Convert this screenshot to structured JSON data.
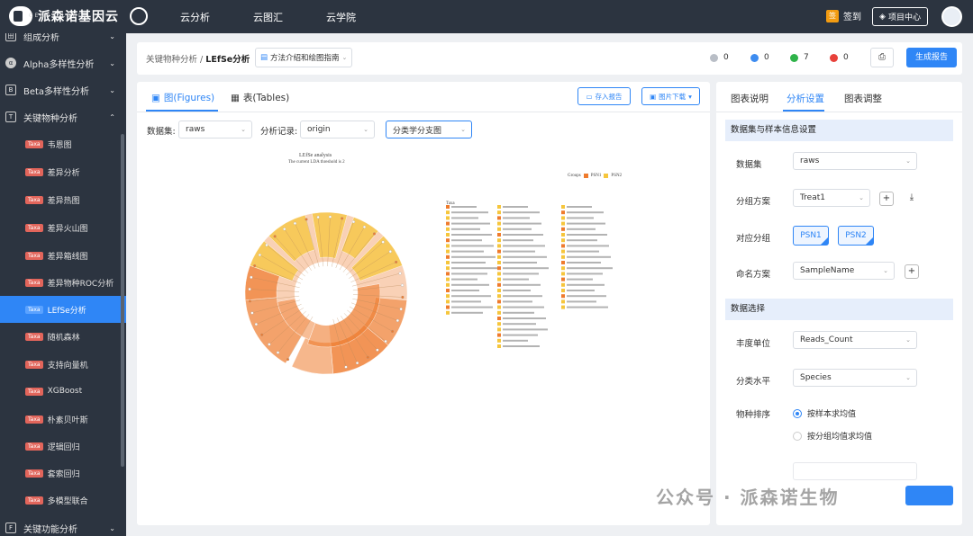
{
  "topbar": {
    "brand": "派森诺基因云",
    "brand_sub": "GENESCLOUD",
    "nav": [
      "云分析",
      "云图汇",
      "云学院"
    ],
    "sign_label": "签到",
    "project_label": "项目中心"
  },
  "sidebar": {
    "groups": [
      {
        "label": "组成分析"
      },
      {
        "label": "Alpha多样性分析"
      },
      {
        "label": "Beta多样性分析"
      },
      {
        "label": "关键物种分析"
      }
    ],
    "items": [
      {
        "tag": "Taxa",
        "label": "韦恩图"
      },
      {
        "tag": "Taxa",
        "label": "差异分析"
      },
      {
        "tag": "Taxa",
        "label": "差异热图"
      },
      {
        "tag": "Taxa",
        "label": "差异火山图"
      },
      {
        "tag": "Taxa",
        "label": "差异箱线图"
      },
      {
        "tag": "Taxa",
        "label": "差异物种ROC分析"
      },
      {
        "tag": "Taxa",
        "label": "LEfSe分析"
      },
      {
        "tag": "Taxa",
        "label": "随机森林"
      },
      {
        "tag": "Taxa",
        "label": "支持向量机"
      },
      {
        "tag": "Taxa",
        "label": "XGBoost"
      },
      {
        "tag": "Taxa",
        "label": "朴素贝叶斯"
      },
      {
        "tag": "Taxa",
        "label": "逻辑回归"
      },
      {
        "tag": "Taxa",
        "label": "套索回归"
      },
      {
        "tag": "Taxa",
        "label": "多模型联合"
      }
    ],
    "bottom_group": {
      "label": "关键功能分析"
    },
    "active_index": 6
  },
  "header": {
    "breadcrumb_parent": "关键物种分析",
    "breadcrumb_sep": "/",
    "breadcrumb_current": "LEfSe分析",
    "guide_label": "方法介绍和绘图指南",
    "stats": [
      {
        "color": "#b9bec6",
        "value": "0"
      },
      {
        "color": "#3d8cf0",
        "value": "0"
      },
      {
        "color": "#2fb34a",
        "value": "7"
      },
      {
        "color": "#e8413a",
        "value": "0"
      }
    ],
    "generate_label": "生成报告"
  },
  "main": {
    "tab_figures": "图(Figures)",
    "tab_tables": "表(Tables)",
    "save_report_label": "存入报告",
    "download_label": "图片下载",
    "dataset_label": "数据集:",
    "dataset_value": "raws",
    "record_label": "分析记录:",
    "record_value": "origin",
    "figure_type_value": "分类学分支图",
    "figure": {
      "title": "LEfSe analysis",
      "subtitle": "The current LDA threshold is 2",
      "legend_title": "Groups",
      "legend": [
        {
          "name": "PSN1",
          "color": "#ef7b2d"
        },
        {
          "name": "PSN2",
          "color": "#f6c63c"
        }
      ],
      "taxa_header": "Taxa"
    }
  },
  "right": {
    "tabs": [
      "图表说明",
      "分析设置",
      "图表调整"
    ],
    "active_tab": 1,
    "section1": "数据集与样本信息设置",
    "dataset_label": "数据集",
    "dataset_value": "raws",
    "group_scheme_label": "分组方案",
    "group_scheme_value": "Treat1",
    "compare_label": "对应分组",
    "compare_values": [
      "PSN1",
      "PSN2"
    ],
    "naming_label": "命名方案",
    "naming_value": "SampleName",
    "section2": "数据选择",
    "abundance_label": "丰度单位",
    "abundance_value": "Reads_Count",
    "level_label": "分类水平",
    "level_value": "Species",
    "sort_label": "物种排序",
    "sort_options": [
      "按样本求均值",
      "按分组均值求均值"
    ],
    "sort_selected": 0
  },
  "watermark": "公众号 · 派森诺生物"
}
